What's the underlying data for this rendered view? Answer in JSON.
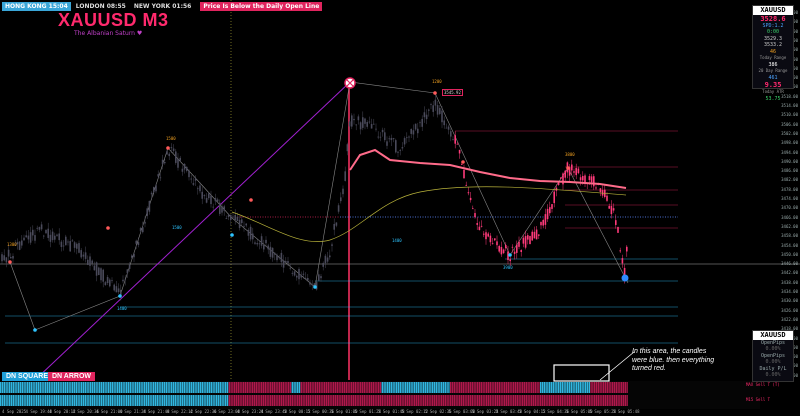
{
  "sessions": {
    "hong_kong": "HONG KONG 15:04",
    "london": "LONDON 08:55",
    "new_york": "NEW YORK 01:56",
    "warning": "Price Is Below the Daily Open Line"
  },
  "title": "XAUUSD M3",
  "subtitle": "The Albanian Saturn ♥",
  "buttons": {
    "square": "DN SQUARE",
    "arrow": "DN ARROW"
  },
  "price_axis": [
    "3554.00",
    "3550.00",
    "3546.00",
    "3542.00",
    "3538.00",
    "3534.00",
    "3530.00",
    "3526.00",
    "3522.00",
    "3518.00",
    "3514.00",
    "3510.00",
    "3506.00",
    "3502.00",
    "3498.00",
    "3494.00",
    "3490.00",
    "3486.00",
    "3482.00",
    "3478.00",
    "3474.00",
    "3470.00",
    "3466.00",
    "3462.00",
    "3458.00",
    "3454.00",
    "3450.00",
    "3446.00",
    "3442.00",
    "3438.00",
    "3434.00",
    "3430.00",
    "3426.00",
    "3422.00",
    "3418.00",
    "3414.00",
    "3410.00",
    "3406.00",
    "3402.00",
    "3398.00"
  ],
  "time_axis": [
    "4 Sep 2025",
    "4 Sep 19:48",
    "4 Sep 20:12",
    "4 Sep 20:36",
    "4 Sep 21:00",
    "4 Sep 21:24",
    "4 Sep 21:48",
    "4 Sep 22:12",
    "4 Sep 22:36",
    "4 Sep 23:00",
    "4 Sep 23:24",
    "4 Sep 23:48",
    "5 Sep 00:12",
    "5 Sep 00:36",
    "5 Sep 01:00",
    "5 Sep 01:24",
    "5 Sep 01:48",
    "5 Sep 02:12",
    "5 Sep 02:36",
    "5 Sep 03:00",
    "5 Sep 03:24",
    "5 Sep 03:48",
    "5 Sep 04:12",
    "5 Sep 04:36",
    "5 Sep 05:00",
    "5 Sep 05:24",
    "5 Sep 05:48"
  ],
  "top_panel": {
    "symbol": "XAUUSD",
    "price": "3528.6",
    "spread": "SPD:1.2",
    "timer": "0:00",
    "l1": "3529.3",
    "l2": "3533.2",
    "l3": "46",
    "today_range_label": "Today Range",
    "today_range": "386",
    "dir_label": "20 Day Range",
    "dir_value": "461",
    "pct": "9.35",
    "atr_label": "Today ATR",
    "atr": "53.75"
  },
  "bottom_panel": {
    "symbol": "XAUUSD",
    "l1": "OpenPips",
    "l2": "0.00%",
    "l3": "OpenPips",
    "l4": "0.00%",
    "l5": "Daily P/L",
    "l6": "0.00%"
  },
  "pivot_labels": {
    "p1": "1500",
    "p2": "1300",
    "p3": "1500",
    "p4": "1400",
    "p5": "3800",
    "p6": "3900",
    "p7": "3545.92",
    "p8": "1200",
    "p9": "1400"
  },
  "panel_labels": {
    "upper": "MAX Sell T (T)",
    "lower": "M15 Sell T"
  },
  "annotation": "In this area, the candles were blue. then everything turned red.",
  "colors": {
    "bull_blue": "#2ec4ff",
    "bear_red": "#e0245e",
    "pink_ma": "#ff6b8a",
    "yellow_ma": "#b8b23a",
    "purple": "#a020d0"
  }
}
